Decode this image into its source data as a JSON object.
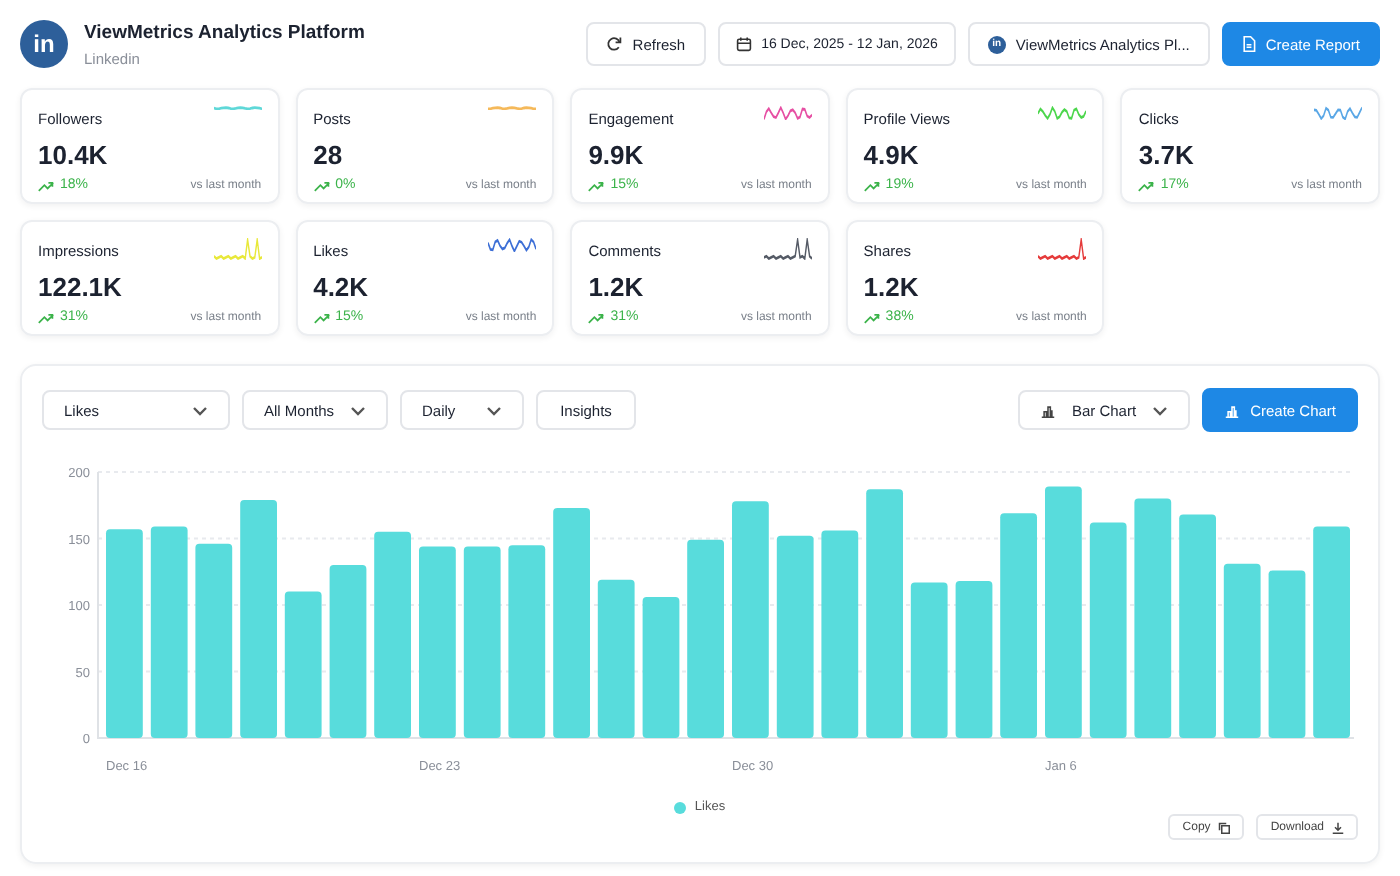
{
  "header": {
    "logo": "in",
    "title": "ViewMetrics Analytics Platform",
    "subtitle": "Linkedin",
    "refresh": "Refresh",
    "date_range": "16 Dec, 2025 - 12 Jan, 2026",
    "account_logo": "in",
    "account": "ViewMetrics Analytics Pl...",
    "create_report": "Create Report"
  },
  "stats": [
    {
      "label": "Followers",
      "value": "10.4K",
      "change": "18%",
      "comparison": "vs last month",
      "color": "#5fd8d8",
      "kind": "flat"
    },
    {
      "label": "Posts",
      "value": "28",
      "change": "0%",
      "comparison": "vs last month",
      "color": "#f5b95a",
      "kind": "flat"
    },
    {
      "label": "Engagement",
      "value": "9.9K",
      "change": "15%",
      "comparison": "vs last month",
      "color": "#e64fa3",
      "kind": "wave"
    },
    {
      "label": "Profile Views",
      "value": "4.9K",
      "change": "19%",
      "comparison": "vs last month",
      "color": "#4cd64c",
      "kind": "wave"
    },
    {
      "label": "Clicks",
      "value": "3.7K",
      "change": "17%",
      "comparison": "vs last month",
      "color": "#5aa7e6",
      "kind": "wave"
    },
    {
      "label": "Impressions",
      "value": "122.1K",
      "change": "31%",
      "comparison": "vs last month",
      "color": "#e8e83a",
      "kind": "spike"
    },
    {
      "label": "Likes",
      "value": "4.2K",
      "change": "15%",
      "comparison": "vs last month",
      "color": "#3d6fd6",
      "kind": "wave"
    },
    {
      "label": "Comments",
      "value": "1.2K",
      "change": "31%",
      "comparison": "vs last month",
      "color": "#555b66",
      "kind": "spike"
    },
    {
      "label": "Shares",
      "value": "1.2K",
      "change": "38%",
      "comparison": "vs last month",
      "color": "#e53b3b",
      "kind": "spike"
    }
  ],
  "chart_panel": {
    "filters": [
      {
        "label": "Likes",
        "kind": "dropdown"
      },
      {
        "label": "All Months",
        "kind": "dropdown"
      },
      {
        "label": "Daily",
        "kind": "dropdown"
      },
      {
        "label": "Insights",
        "kind": "button"
      }
    ],
    "chart_type": "Bar Chart",
    "create_chart": "Create Chart",
    "chart_data": {
      "type": "bar",
      "grid": true,
      "categories": [
        "Dec 16",
        null,
        null,
        null,
        null,
        null,
        null,
        "Dec 23",
        null,
        null,
        null,
        null,
        null,
        null,
        "Dec 30",
        null,
        null,
        null,
        null,
        null,
        null,
        "Jan 6",
        null,
        null,
        null,
        null,
        null,
        null
      ],
      "ylim": [
        0,
        200
      ],
      "yticks": [
        0,
        50,
        100,
        150,
        200
      ],
      "series": [
        {
          "name": "Likes",
          "color": "#58dcdc",
          "values": [
            157,
            159,
            146,
            179,
            110,
            130,
            155,
            144,
            144,
            145,
            173,
            119,
            106,
            149,
            178,
            152,
            156,
            187,
            117,
            118,
            169,
            189,
            162,
            180,
            168,
            131,
            126,
            159
          ]
        }
      ]
    },
    "actions": [
      "Copy",
      "Download"
    ]
  }
}
